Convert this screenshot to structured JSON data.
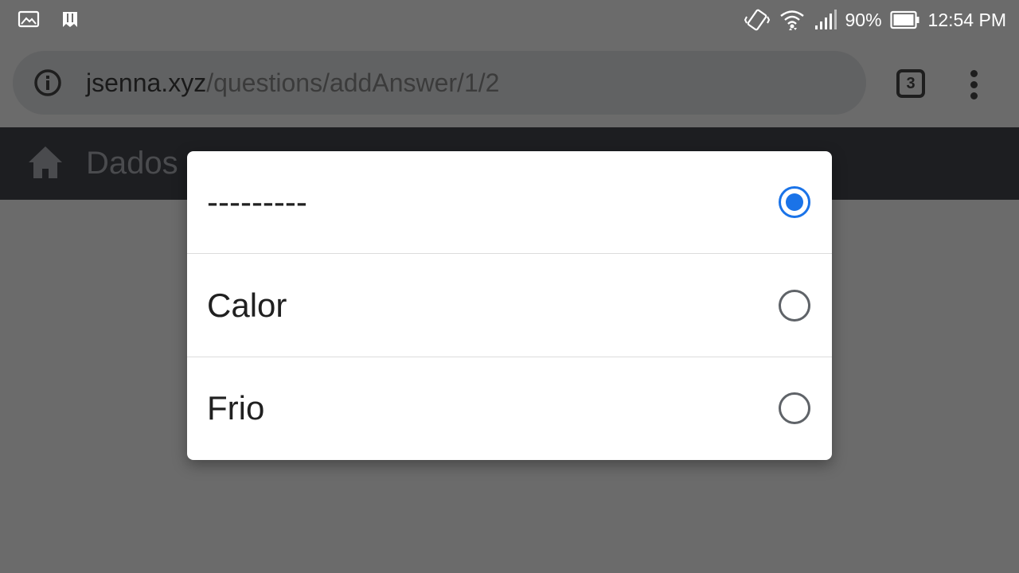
{
  "status_bar": {
    "left_icons": [
      "image-icon",
      "bookmark-icon"
    ],
    "right_icons": [
      "vibrate-icon",
      "wifi-icon",
      "signal-icon",
      "battery-icon"
    ],
    "battery": "90%",
    "time": "12:54 PM"
  },
  "browser": {
    "url_host": "jsenna.xyz",
    "url_path": "/questions/addAnswer/1/2",
    "tab_count": "3",
    "icons": [
      "info-icon",
      "menu-dots-icon"
    ]
  },
  "page": {
    "title": "Dados"
  },
  "dialog": {
    "options": [
      {
        "label": "---------",
        "selected": true
      },
      {
        "label": "Calor",
        "selected": false
      },
      {
        "label": "Frio",
        "selected": false
      }
    ]
  },
  "colors": {
    "scrim": "#6b6b6b",
    "header": "#1d1e21",
    "accent": "#1a73e8",
    "radio_off": "#5f6368"
  }
}
